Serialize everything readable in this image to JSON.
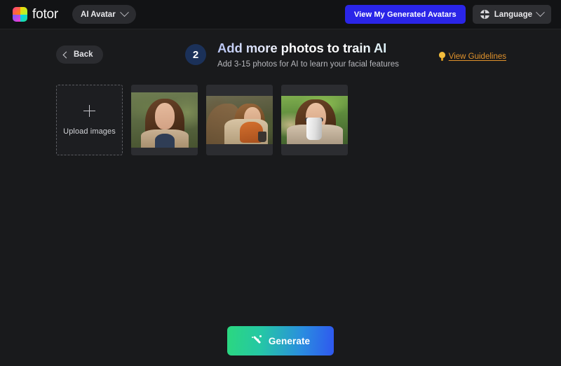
{
  "topbar": {
    "brand_name": "fotor",
    "logo_icon": "fotor-rainbow-logo-icon",
    "app_switcher": {
      "label": "AI Avatar",
      "chevron_icon": "chevron-down-icon"
    },
    "view_avatars_button": "View My Generated Avatars",
    "language": {
      "label": "Language",
      "globe_icon": "globe-icon",
      "chevron_icon": "chevron-down-icon"
    }
  },
  "header": {
    "back_label": "Back",
    "back_icon": "chevron-left-icon",
    "step_number": "2",
    "title": "Add more photos to train AI",
    "subtitle": "Add 3-15 photos for AI to learn your facial features",
    "guidelines_label": "View Guidelines",
    "guidelines_icon": "lightbulb-icon"
  },
  "uploader": {
    "plus_icon": "plus-icon",
    "upload_label": "Upload images",
    "photos": [
      {
        "alt": "woman-portrait-green-field"
      },
      {
        "alt": "woman-rust-scarf-autumn-park"
      },
      {
        "alt": "woman-holding-coffee-cup-grass"
      }
    ]
  },
  "footer": {
    "generate_label": "Generate",
    "generate_icon": "magic-wand-icon"
  },
  "colors": {
    "page_background": "#191a1c",
    "topbar_background": "#121315",
    "accent_blue": "#2a25e8",
    "guidelines_orange": "#e0922c",
    "step_badge": "#1b3159",
    "generate_gradient_start": "#2bd87f",
    "generate_gradient_end": "#2f57ef"
  }
}
